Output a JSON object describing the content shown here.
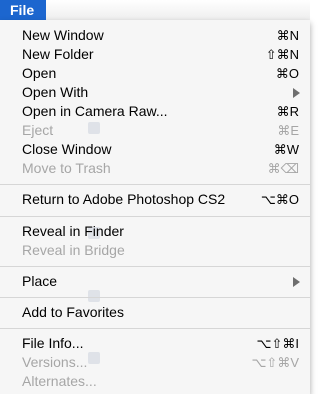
{
  "menubar": {
    "title": "File"
  },
  "colors": {
    "highlight": "#1c66cf",
    "enabled_text": "#000000",
    "disabled_text": "#a6a6a6",
    "separator": "#d6d6d6"
  },
  "items": [
    {
      "label": "New Window",
      "shortcut": "⌘N",
      "enabled": true
    },
    {
      "label": "New Folder",
      "shortcut": "⇧⌘N",
      "enabled": true
    },
    {
      "label": "Open",
      "shortcut": "⌘O",
      "enabled": true
    },
    {
      "label": "Open With",
      "shortcut": "",
      "submenu": true,
      "enabled": true
    },
    {
      "label": "Open in Camera Raw...",
      "shortcut": "⌘R",
      "enabled": true
    },
    {
      "label": "Eject",
      "shortcut": "⌘E",
      "enabled": false
    },
    {
      "label": "Close Window",
      "shortcut": "⌘W",
      "enabled": true
    },
    {
      "label": "Move to Trash",
      "shortcut": "⌘⌫",
      "enabled": false
    },
    {
      "label": "Return to Adobe Photoshop CS2",
      "shortcut": "⌥⌘O",
      "enabled": true
    },
    {
      "label": "Reveal in Finder",
      "shortcut": "",
      "enabled": true
    },
    {
      "label": "Reveal in Bridge",
      "shortcut": "",
      "enabled": false
    },
    {
      "label": "Place",
      "shortcut": "",
      "submenu": true,
      "enabled": true
    },
    {
      "label": "Add to Favorites",
      "shortcut": "",
      "enabled": true
    },
    {
      "label": "File Info...",
      "shortcut": "⌥⇧⌘I",
      "enabled": true
    },
    {
      "label": "Versions...",
      "shortcut": "⌥⇧⌘V",
      "enabled": false
    },
    {
      "label": "Alternates...",
      "shortcut": "",
      "enabled": false
    }
  ]
}
